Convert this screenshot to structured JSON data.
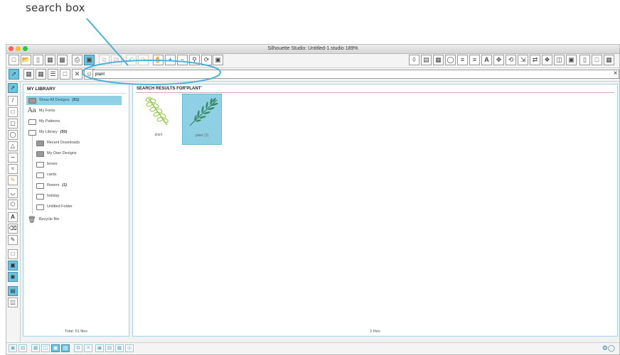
{
  "annotation": {
    "label": "search box"
  },
  "window": {
    "title": "Silhouette Studio: Untitled-1.studio 189%"
  },
  "search": {
    "value": "plant",
    "clear_icon": "×"
  },
  "library": {
    "header": "MY LIBRARY",
    "items": [
      {
        "label": "Show All Designs",
        "count": "(51)"
      },
      {
        "label": "My Fonts",
        "icon": "Aa"
      },
      {
        "label": "My Patterns"
      },
      {
        "label": "My Library",
        "count": "(50)"
      },
      {
        "label": "Recent Downloads"
      },
      {
        "label": "My Own Designs"
      },
      {
        "label": "boxes"
      },
      {
        "label": "cards"
      },
      {
        "label": "flowers",
        "count": "(1)"
      },
      {
        "label": "holiday"
      },
      {
        "label": "Untitled Folder"
      },
      {
        "label": "Recycle Bin"
      }
    ],
    "total": "Total: 51 files"
  },
  "results": {
    "header": "SEARCH RESULTS FOR'PLANT'",
    "items": [
      {
        "label": "plant",
        "color": "#8cc63f"
      },
      {
        "label": "plant (2)",
        "color": "#3d8a6b"
      }
    ],
    "count": "2 files"
  },
  "colors": {
    "accent": "#6ec3df",
    "selected": "#8fd0e5",
    "annotation": "#4ab3d8"
  }
}
